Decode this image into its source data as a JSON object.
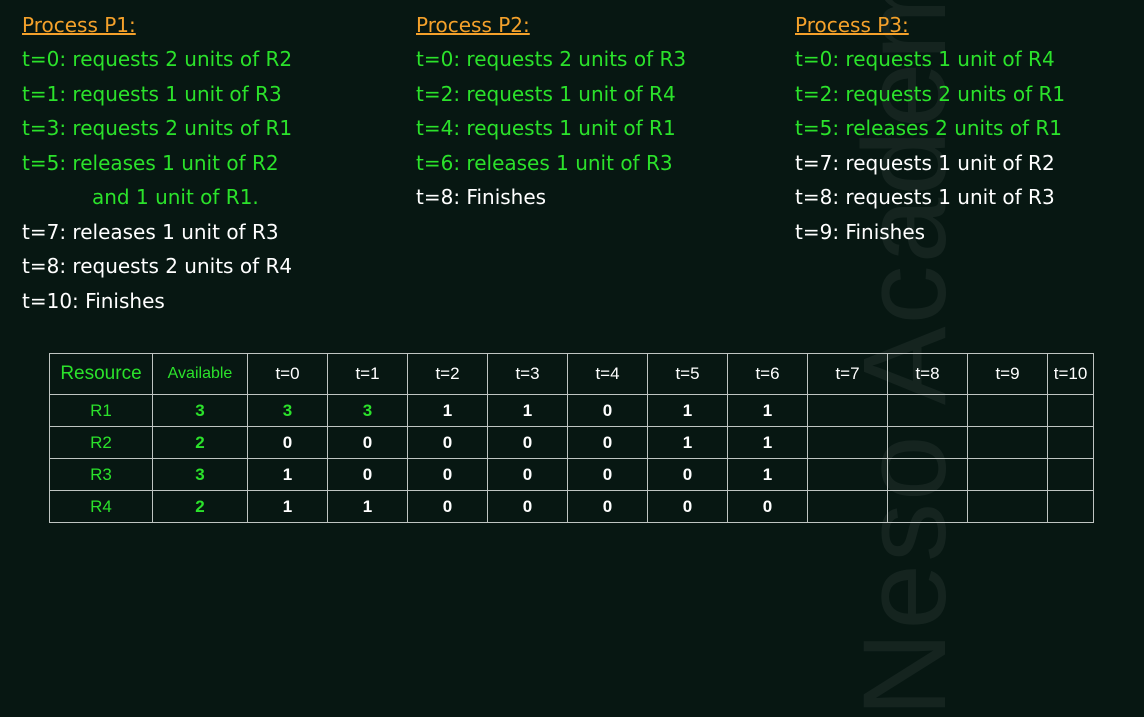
{
  "watermark": "Neso Academy",
  "processes": [
    {
      "title": "Process P1:",
      "lines": [
        {
          "text": "t=0: requests 2 units of R2",
          "color": "green"
        },
        {
          "text": "t=1: requests 1 unit of R3",
          "color": "green"
        },
        {
          "text": "t=3: requests 2 units of R1",
          "color": "green"
        },
        {
          "text": "t=5: releases 1 unit of R2",
          "color": "green"
        },
        {
          "text": "and 1 unit of R1.",
          "color": "green",
          "indent": true
        },
        {
          "text": "t=7: releases 1 unit of R3",
          "color": "white"
        },
        {
          "text": "t=8: requests 2 units of R4",
          "color": "white"
        },
        {
          "text": "t=10: Finishes",
          "color": "white"
        }
      ]
    },
    {
      "title": "Process P2:",
      "lines": [
        {
          "text": "t=0: requests 2 units of R3",
          "color": "green"
        },
        {
          "text": "t=2: requests 1 unit of R4",
          "color": "green"
        },
        {
          "text": "t=4: requests 1 unit of R1",
          "color": "green"
        },
        {
          "text": "t=6: releases 1 unit of R3",
          "color": "green"
        },
        {
          "text": "t=8: Finishes",
          "color": "white"
        }
      ]
    },
    {
      "title": "Process P3:",
      "lines": [
        {
          "text": "t=0: requests 1 unit of R4",
          "color": "green"
        },
        {
          "text": "t=2: requests 2 units of R1",
          "color": "green"
        },
        {
          "text": "t=5: releases 2 units of R1",
          "color": "green"
        },
        {
          "text": "t=7: requests 1 unit of R2",
          "color": "white"
        },
        {
          "text": "t=8: requests 1 unit of R3",
          "color": "white"
        },
        {
          "text": "t=9: Finishes",
          "color": "white"
        }
      ]
    }
  ],
  "table": {
    "headers": [
      "Resource",
      "Available",
      "t=0",
      "t=1",
      "t=2",
      "t=3",
      "t=4",
      "t=5",
      "t=6",
      "t=7",
      "t=8",
      "t=9",
      "t=10"
    ],
    "rows": [
      {
        "resource": "R1",
        "available": "3",
        "values": [
          "3",
          "3",
          "1",
          "1",
          "0",
          "1",
          "1",
          "",
          "",
          "",
          ""
        ]
      },
      {
        "resource": "R2",
        "available": "2",
        "values": [
          "0",
          "0",
          "0",
          "0",
          "0",
          "1",
          "1",
          "",
          "",
          "",
          ""
        ]
      },
      {
        "resource": "R3",
        "available": "3",
        "values": [
          "1",
          "0",
          "0",
          "0",
          "0",
          "0",
          "1",
          "",
          "",
          "",
          ""
        ]
      },
      {
        "resource": "R4",
        "available": "2",
        "values": [
          "1",
          "1",
          "0",
          "0",
          "0",
          "0",
          "0",
          "",
          "",
          "",
          ""
        ]
      }
    ]
  },
  "colors": {
    "background": "#071712",
    "title": "#f4a12b",
    "green": "#2be22b",
    "white": "#ffffff",
    "border": "#bfc5c2"
  }
}
